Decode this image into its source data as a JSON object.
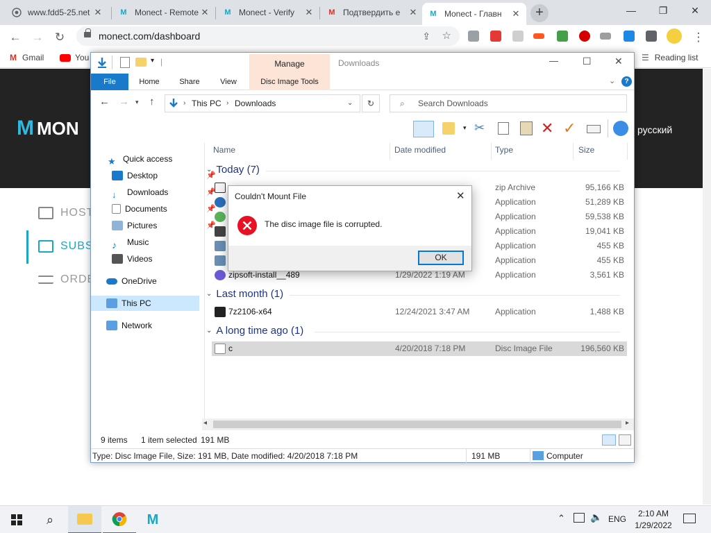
{
  "browser": {
    "tabs": [
      {
        "title": "www.fdd5-25.net",
        "favicon": "globe-icon",
        "active": false
      },
      {
        "title": "Monect - Remote",
        "favicon": "monect-icon",
        "active": false
      },
      {
        "title": "Monect - Verify",
        "favicon": "monect-icon",
        "active": false
      },
      {
        "title": "Подтвердить e",
        "favicon": "gmail-icon",
        "active": false
      },
      {
        "title": "Monect - Главн",
        "favicon": "monect-icon",
        "active": true
      }
    ],
    "url": "monect.com/dashboard",
    "bookmarks": [
      {
        "label": "Gmail",
        "icon": "gmail-icon"
      },
      {
        "label": "You",
        "icon": "youtube-icon"
      }
    ],
    "reading_list": "Reading list"
  },
  "site": {
    "logo_text": "MON",
    "language": "русский",
    "menu": [
      "HOST",
      "SUBS",
      "ORDE"
    ]
  },
  "explorer": {
    "title": "Downloads",
    "quick_toolbar_sep": "|",
    "contextual_group": "Manage",
    "ribbon_tabs": [
      "File",
      "Home",
      "Share",
      "View",
      "Disc Image Tools"
    ],
    "path": [
      "This PC",
      "Downloads"
    ],
    "search_placeholder": "Search Downloads",
    "columns": {
      "name": "Name",
      "date": "Date modified",
      "type": "Type",
      "size": "Size"
    },
    "nav": {
      "quick_access": "Quick access",
      "desktop": "Desktop",
      "downloads": "Downloads",
      "documents": "Documents",
      "pictures": "Pictures",
      "music": "Music",
      "videos": "Videos",
      "onedrive": "OneDrive",
      "thispc": "This PC",
      "network": "Network"
    },
    "groups": {
      "today": "Today (7)",
      "last_month": "Last month (1)",
      "long_ago": "A long time ago (1)"
    },
    "files_today": [
      {
        "name": "",
        "date": "",
        "type": "zip Archive",
        "size": "95,166 KB",
        "icon": "zip-icon"
      },
      {
        "name": "",
        "date": "",
        "type": "Application",
        "size": "51,289 KB",
        "icon": "app-globe-icon"
      },
      {
        "name": "",
        "date": "",
        "type": "Application",
        "size": "59,538 KB",
        "icon": "app-green-icon"
      },
      {
        "name": "",
        "date": "",
        "type": "Application",
        "size": "19,041 KB",
        "icon": "app-film-icon"
      },
      {
        "name": "",
        "date": "",
        "type": "Application",
        "size": "455 KB",
        "icon": "installer-icon"
      },
      {
        "name": "",
        "date": "",
        "type": "Application",
        "size": "455 KB",
        "icon": "installer-icon"
      },
      {
        "name": "zipsoft-install__489",
        "date": "1/29/2022 1:19 AM",
        "type": "Application",
        "size": "3,561 KB",
        "icon": "zipsoft-icon"
      }
    ],
    "file_last_month": {
      "name": "7z2106-x64",
      "date": "12/24/2021 3:47 AM",
      "type": "Application",
      "size": "1,488 KB",
      "icon": "7zip-icon"
    },
    "file_long_ago": {
      "name": "c",
      "date": "4/20/2018 7:18 PM",
      "type": "Disc Image File",
      "size": "196,560 KB",
      "icon": "disc-image-icon"
    },
    "status": {
      "items": "9 items",
      "selected": "1 item selected",
      "selected_size": "191 MB"
    },
    "details": {
      "text": "Type: Disc Image File, Size: 191 MB, Date modified: 4/20/2018 7:18 PM",
      "size": "191 MB",
      "location": "Computer"
    }
  },
  "dialog": {
    "title": "Couldn't Mount File",
    "message": "The disc image file is corrupted.",
    "ok": "OK"
  },
  "taskbar": {
    "time": "2:10 AM",
    "date": "1/29/2022",
    "lang": "ENG"
  },
  "colors": {
    "explorer_accent": "#1979ca",
    "manage_tab": "#fce4d6",
    "error_red": "#e81123",
    "dialog_ok_border": "#0078d7"
  }
}
